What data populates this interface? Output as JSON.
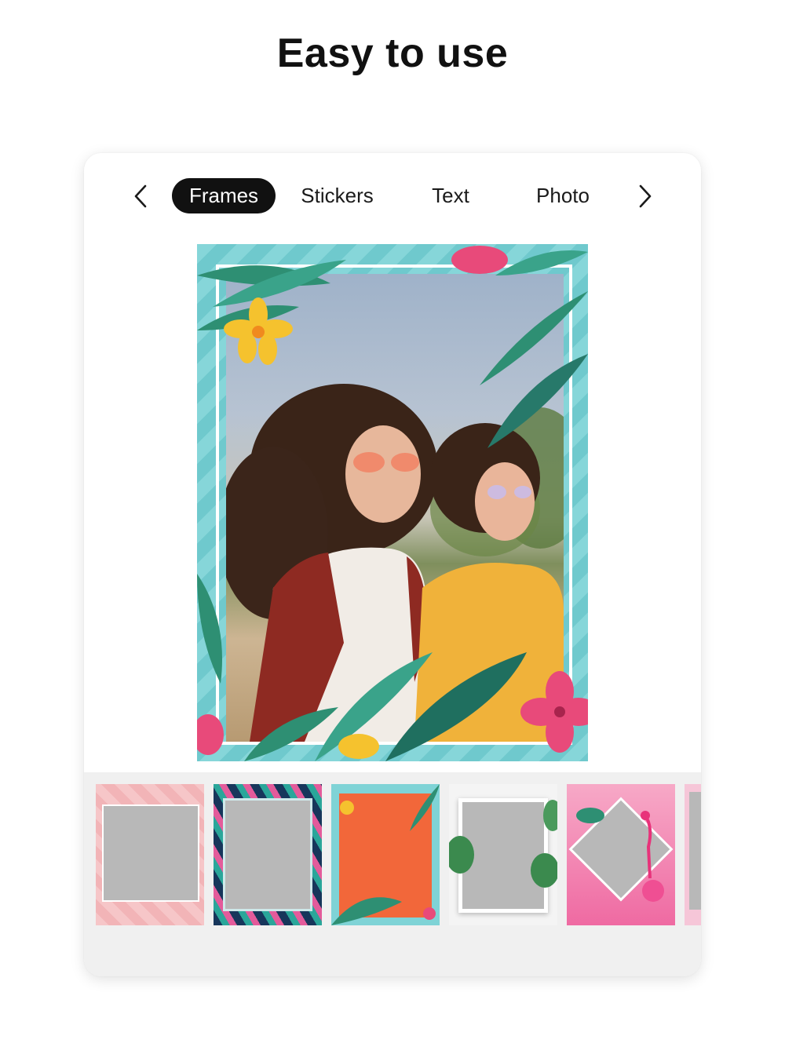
{
  "headline": "Easy to use",
  "tabbar": {
    "prev_icon": "chevron-left-icon",
    "next_icon": "chevron-right-icon",
    "tabs": [
      {
        "label": "Frames",
        "active": true
      },
      {
        "label": "Stickers",
        "active": false
      },
      {
        "label": "Text",
        "active": false
      },
      {
        "label": "Photo",
        "active": false
      }
    ]
  },
  "preview": {
    "frame_style": "tropical leaves frame",
    "frame_colors": {
      "teal": "#7fd3d6",
      "leaf": "#2e8f73",
      "flower_yellow": "#f5c22e",
      "flower_pink": "#e84a7a"
    }
  },
  "thumbnails": [
    {
      "style": "pink flamingo pattern"
    },
    {
      "style": "navy tropical leaves"
    },
    {
      "style": "orange with teal leaves"
    },
    {
      "style": "white with monstera leaves"
    },
    {
      "style": "pink flamingo diamond"
    },
    {
      "style": "pink partial"
    }
  ],
  "colors": {
    "active_tab_bg": "#111111",
    "active_tab_text": "#ffffff",
    "strip_bg": "#f0f0f0",
    "placeholder": "#b8b8b8"
  }
}
